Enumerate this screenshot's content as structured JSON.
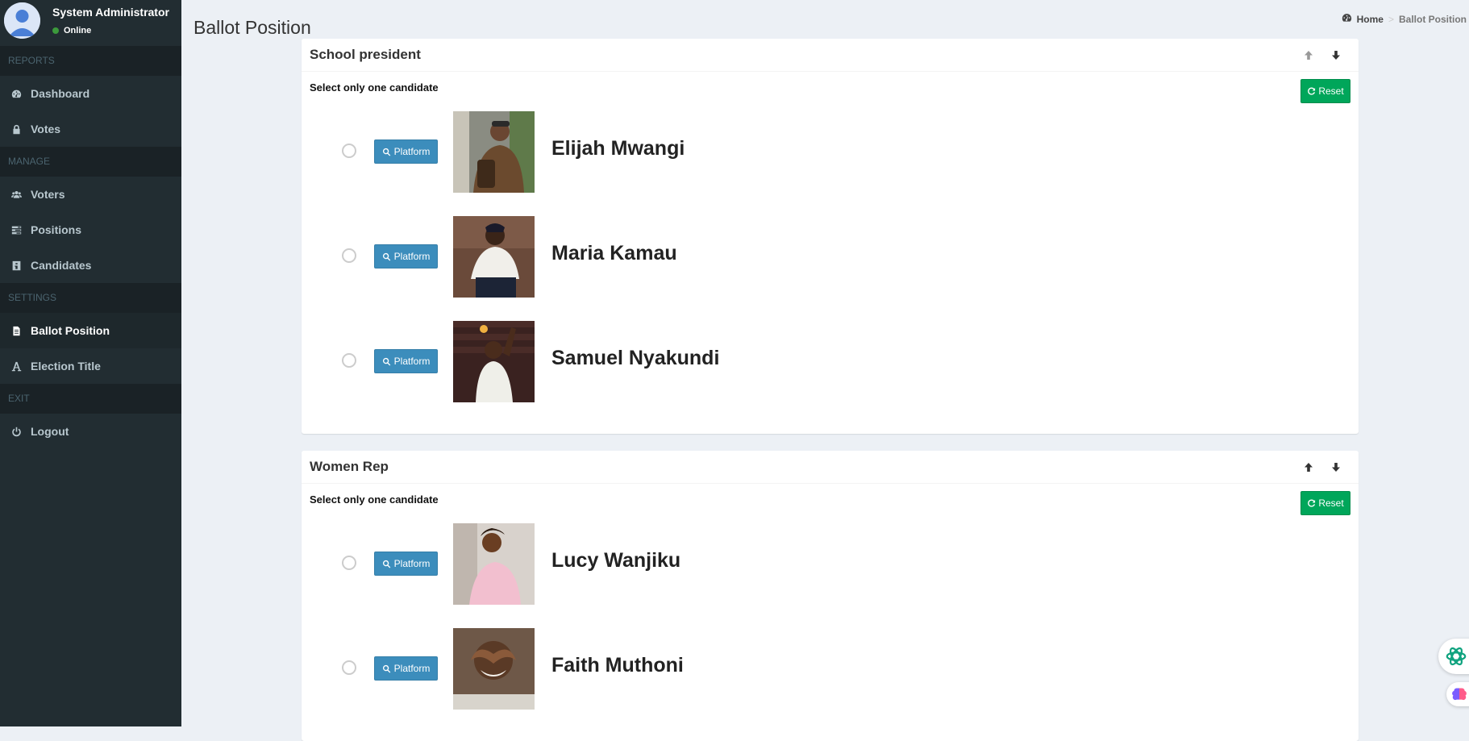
{
  "user": {
    "name": "System Administrator",
    "status": "Online"
  },
  "sidebar": {
    "sections": [
      {
        "header": "REPORTS",
        "items": [
          {
            "label": "Dashboard",
            "icon": "dashboard-icon"
          },
          {
            "label": "Votes",
            "icon": "lock-icon"
          }
        ]
      },
      {
        "header": "MANAGE",
        "items": [
          {
            "label": "Voters",
            "icon": "users-icon"
          },
          {
            "label": "Positions",
            "icon": "tasks-icon"
          },
          {
            "label": "Candidates",
            "icon": "id-card-icon"
          }
        ]
      },
      {
        "header": "SETTINGS",
        "items": [
          {
            "label": "Ballot Position",
            "icon": "file-text-icon",
            "active": true
          },
          {
            "label": "Election Title",
            "icon": "font-icon"
          }
        ]
      },
      {
        "header": "EXIT",
        "items": [
          {
            "label": "Logout",
            "icon": "power-off-icon"
          }
        ]
      }
    ]
  },
  "page": {
    "title": "Ballot Position"
  },
  "breadcrumb": {
    "home": "Home",
    "separator": ">",
    "current": "Ballot Position"
  },
  "positions": [
    {
      "title": "School president",
      "instruction": "Select only one candidate",
      "reset_label": "Reset",
      "candidates": [
        {
          "name": "Elijah Mwangi",
          "platform_label": "Platform"
        },
        {
          "name": "Maria Kamau",
          "platform_label": "Platform"
        },
        {
          "name": "Samuel Nyakundi",
          "platform_label": "Platform"
        }
      ]
    },
    {
      "title": "Women Rep",
      "instruction": "Select only one candidate",
      "reset_label": "Reset",
      "candidates": [
        {
          "name": "Lucy Wanjiku",
          "platform_label": "Platform"
        },
        {
          "name": "Faith Muthoni",
          "platform_label": "Platform"
        }
      ]
    }
  ],
  "colors": {
    "sidebar_bg": "#222d32",
    "primary": "#3c8dbc",
    "success": "#00a65a",
    "online": "#3c9a3c"
  }
}
